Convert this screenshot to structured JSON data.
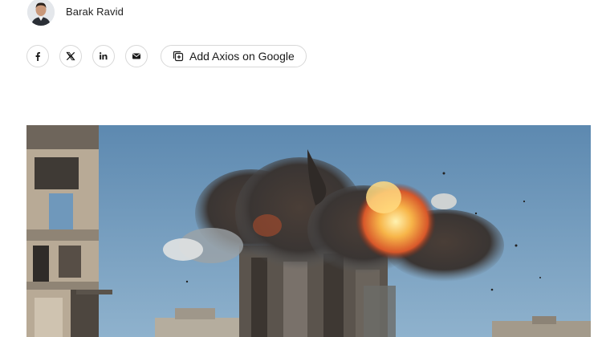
{
  "author": {
    "name": "Barak Ravid",
    "avatar_icon": "person-avatar"
  },
  "share": {
    "buttons": [
      {
        "name": "facebook",
        "icon": "facebook-icon"
      },
      {
        "name": "x",
        "icon": "x-icon"
      },
      {
        "name": "linkedin",
        "icon": "linkedin-icon"
      },
      {
        "name": "email",
        "icon": "mail-icon"
      }
    ],
    "google_label": "Add Axios on Google",
    "google_icon": "add-source-icon"
  },
  "hero_image": {
    "description_icon": "photo",
    "colors": {
      "sky": "#6f98bb",
      "smoke": "#3b3633",
      "fire": "#f0a43c"
    }
  }
}
